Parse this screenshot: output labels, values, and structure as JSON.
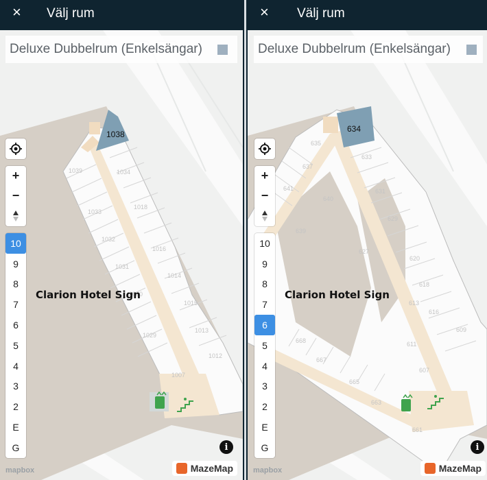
{
  "panels": [
    {
      "title": "Välj rum",
      "room_name": "Deluxe Dubbelrum (Enkelsängar)",
      "highlighted_room": "1038",
      "building_label": "Clarion Hotel Sign",
      "active_floor": "10",
      "room_numbers": [
        "1039",
        "1034",
        "1033",
        "1032",
        "1031",
        "1030",
        "1029",
        "1018",
        "1016",
        "1014",
        "1015",
        "1013",
        "1012",
        "1007"
      ]
    },
    {
      "title": "Välj rum",
      "room_name": "Deluxe Dubbelrum (Enkelsängar)",
      "highlighted_room": "634",
      "building_label": "Clarion Hotel Sign",
      "active_floor": "6",
      "room_numbers": [
        "635",
        "637",
        "641",
        "640",
        "639",
        "633",
        "631",
        "629",
        "630",
        "627",
        "620",
        "618",
        "616",
        "613",
        "611",
        "607",
        "609",
        "668",
        "667",
        "665",
        "661",
        "663"
      ]
    }
  ],
  "controls": {
    "close_icon": "×",
    "locate_icon": "crosshair-icon",
    "zoom_in": "+",
    "zoom_out": "−",
    "compass_icon": "compass-icon",
    "info_icon": "i"
  },
  "floors": [
    "10",
    "9",
    "8",
    "7",
    "6",
    "5",
    "4",
    "3",
    "2",
    "E",
    "G"
  ],
  "attribution": {
    "mapbox": "mapbox",
    "mazemap": "MazeMap"
  },
  "colors": {
    "topbar": "#0f2430",
    "active_floor": "#3d8fe3",
    "highlight_room": "#7f9fb3",
    "corridor": "#f6e7d2",
    "elevator_green": "#3fa34d"
  }
}
